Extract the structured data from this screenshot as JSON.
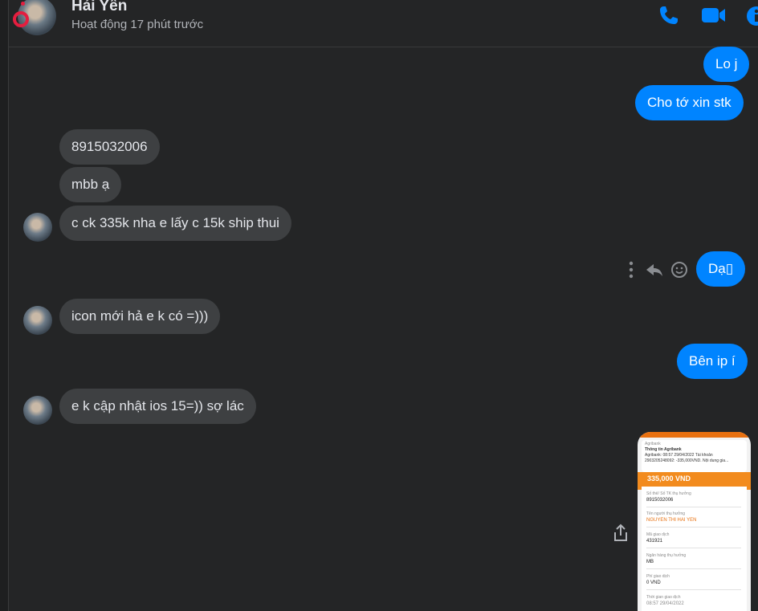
{
  "header": {
    "contact_name": "Hải Yến",
    "status": "Hoạt động 17 phút trước",
    "icons": [
      "phone-icon",
      "video-icon",
      "info-icon"
    ],
    "accent_color": "#0084ff"
  },
  "messages": [
    {
      "side": "out",
      "text": "Lo j"
    },
    {
      "side": "out",
      "text": "Cho tớ xin stk"
    },
    {
      "side": "in",
      "text": "8915032006"
    },
    {
      "side": "in",
      "text": "mbb ạ"
    },
    {
      "side": "in",
      "text": "c ck 335k nha e lấy c 15k ship thui"
    },
    {
      "side": "out",
      "text": "Dạ▯"
    },
    {
      "side": "in",
      "text": "icon mới hả e k có =)))"
    },
    {
      "side": "out",
      "text": "Bên ip í"
    },
    {
      "side": "in",
      "text": "e k cập nhật ios 15=)) sợ lác"
    }
  ],
  "message_actions": [
    "more-icon",
    "reply-icon",
    "emoji-icon"
  ],
  "attachment": {
    "bank": "Agribank",
    "notif_title": "Thông tin Agribank",
    "notif_line1": "Agribank: 08:57 29/04/2022 Tài khoản",
    "notif_line2": "2903205248092: -335,000VND. Nội dung gia...",
    "amount": "335,000 VND",
    "fields": [
      {
        "label": "Số thẻ/ Số TK thụ hưởng",
        "value": "8915032006"
      },
      {
        "label": "Tên người thụ hưởng",
        "value": "NGUYEN THI HAI YEN"
      },
      {
        "label": "Mã giao dịch",
        "value": "431921"
      },
      {
        "label": "Ngân hàng thụ hưởng",
        "value": "MB"
      },
      {
        "label": "Phí giao dịch",
        "value": "0 VND"
      },
      {
        "label": "Thời gian giao dịch",
        "value": "08:57 29/04/2022"
      }
    ]
  }
}
